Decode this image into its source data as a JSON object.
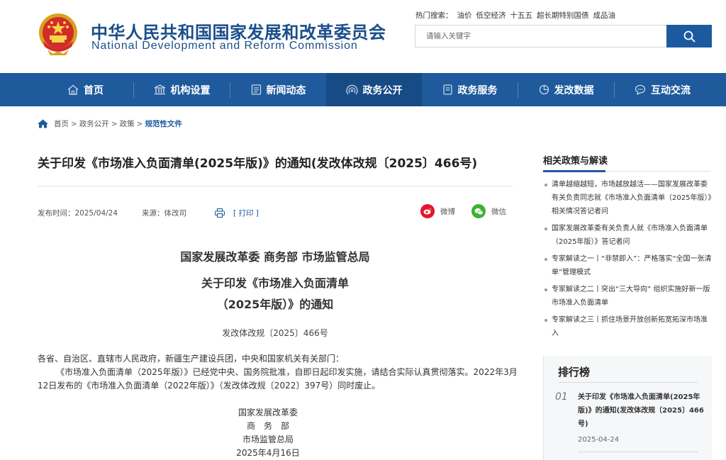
{
  "header": {
    "cn_title": "中华人民共和国国家发展和改革委员会",
    "en_title": "National Development and Reform Commission",
    "hot_label": "热门搜索：",
    "hot_terms": [
      "油价",
      "低空经济",
      "十五五",
      "超长期特别国债",
      "成品油"
    ],
    "search_placeholder": "请输入关键字"
  },
  "nav": {
    "items": [
      {
        "label": "首页",
        "icon": "home-icon"
      },
      {
        "label": "机构设置",
        "icon": "building-icon"
      },
      {
        "label": "新闻动态",
        "icon": "news-icon"
      },
      {
        "label": "政务公开",
        "icon": "broadcast-icon"
      },
      {
        "label": "政务服务",
        "icon": "service-icon"
      },
      {
        "label": "发改数据",
        "icon": "pie-chart-icon"
      },
      {
        "label": "互动交流",
        "icon": "chat-icon"
      }
    ],
    "active": "政务公开"
  },
  "breadcrumb": {
    "items": [
      "首页",
      "政务公开",
      "政策"
    ],
    "current": "规范性文件",
    "separator": ">"
  },
  "article": {
    "title": "关于印发《市场准入负面清单(2025年版)》的通知(发改体改规〔2025〕466号)",
    "publish_label": "发布时间：",
    "publish_date": "2025/04/24",
    "source_label": "来源：",
    "source": "体改司",
    "print_label": "[ 打印 ]",
    "share_weibo": "微博",
    "share_wechat": "微信",
    "issuers": "国家发展改革委 商务部 市场监管总局",
    "doc_title_1": "关于印发《市场准入负面清单",
    "doc_title_2": "（2025年版）》的通知",
    "doc_number": "发改体改规〔2025〕466号",
    "recipients": "各省、自治区、直辖市人民政府，新疆生产建设兵团，中央和国家机关有关部门：",
    "body": "《市场准入负面清单（2025年版）》已经党中央、国务院批准，自即日起印发实施，请结合实际认真贯彻落实。2022年3月12日发布的《市场准入负面清单（2022年版）》（发改体改规〔2022〕397号）同时废止。",
    "signatures": [
      "国家发展改革委",
      "商　务　部",
      "市场监管总局",
      "2025年4月16日"
    ]
  },
  "sidebar": {
    "related_title": "相关政策与解读",
    "related": [
      "清单越缩越短，市场越放越活——国家发展改革委有关负责同志就《市场准入负面清单（2025年版）》相关情况答记者问",
      "国家发展改革委有关负责人就《市场准入负面清单（2025年版）》答记者问",
      "专家解读之一丨“非禁即入”：严格落实“全国一张清单”管理模式",
      "专家解读之二丨突出“三大导向” 组织实施好新一版市场准入负面清单",
      "专家解读之三丨抓住场景开放创新拓宽拓深市场准入"
    ],
    "rank_title": "排行榜",
    "rank": [
      {
        "num": "01",
        "title": "关于印发《市场准入负面清单(2025年版)》的通知(发改体改规〔2025〕466号)",
        "date": "2025-04-24"
      }
    ]
  },
  "colors": {
    "brand": "#1e5a9c",
    "nav_active": "#174b85",
    "weibo": "#e6162d",
    "wechat": "#3eb135"
  }
}
